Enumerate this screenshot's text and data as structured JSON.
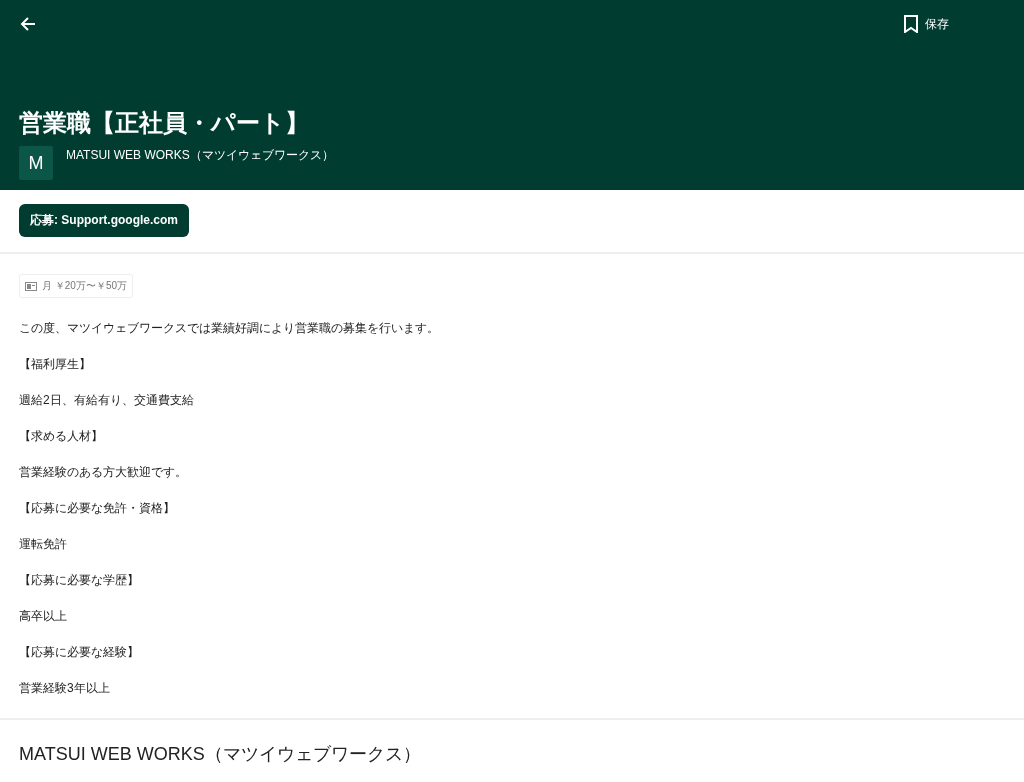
{
  "header": {
    "save_label": "保存",
    "title": "営業職【正社員・パート】",
    "avatar_letter": "M",
    "company": "MATSUI WEB WORKS（マツイウェブワークス）"
  },
  "apply_button": "応募: Support.google.com",
  "salary": "月 ￥20万〜￥50万",
  "description": [
    "この度、マツイウェブワークスでは業績好調により営業職の募集を行います。",
    "【福利厚生】",
    "週給2日、有給有り、交通費支給",
    "【求める人材】",
    "営業経験のある方大歓迎です。",
    "【応募に必要な免許・資格】",
    "運転免許",
    "【応募に必要な学歴】",
    "高卒以上",
    "【応募に必要な経験】",
    "営業経験3年以上"
  ],
  "company_section": {
    "title": "MATSUI WEB WORKS（マツイウェブワークス）"
  }
}
